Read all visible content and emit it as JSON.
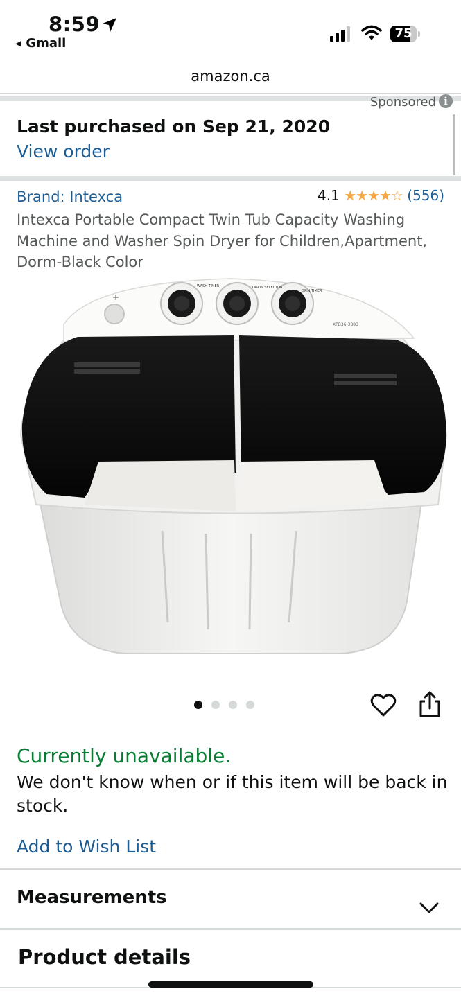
{
  "status_bar": {
    "time": "8:59",
    "back_app": "◂ Gmail",
    "battery": "75"
  },
  "browser": {
    "url": "amazon.ca"
  },
  "sponsored": {
    "label": "Sponsored",
    "info_icon": "i"
  },
  "purchase": {
    "last_purchased": "Last purchased on Sep 21, 2020",
    "view_order": "View order"
  },
  "product": {
    "brand": "Brand: Intexca",
    "rating": "4.1",
    "stars": "★★★★☆",
    "rating_count": "(556)",
    "title": "Intexca Portable Compact Twin Tub Capacity Washing Machine and Washer Spin Dryer for Children,Apartment, Dorm-Black Color",
    "image_labels": {
      "wash_timer": "WASH TIMER",
      "drain_selector": "DRAIN SELECTOR",
      "spin_timer": "SPIN TIMER",
      "model": "XPB36-3883"
    },
    "image_count": 4,
    "active_image": 1
  },
  "availability": {
    "status": "Currently unavailable.",
    "message": "We don't know when or if this item will be back in stock.",
    "wishlist": "Add to Wish List"
  },
  "sections": {
    "measurements": "Measurements",
    "product_details": "Product details"
  },
  "colors": {
    "link": "#1d5d95",
    "available_green": "#067d32",
    "star": "#f3a847"
  }
}
